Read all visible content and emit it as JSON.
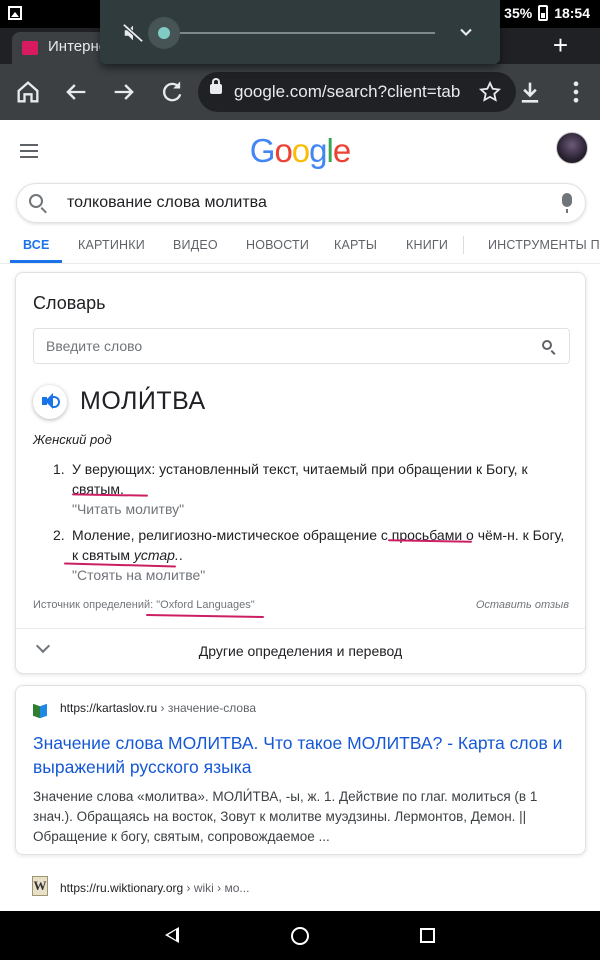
{
  "status_bar": {
    "battery": "35%",
    "time": "18:54"
  },
  "volume": {
    "level": 0.0,
    "mute_icon": "volume-off-icon"
  },
  "browser": {
    "tab_title": "Интерне",
    "url": "google.com/search?client=tab",
    "icons": [
      "home-icon",
      "back-arrow-icon",
      "forward-arrow-icon",
      "refresh-icon",
      "lock-icon",
      "star-icon",
      "download-icon",
      "more-vert-icon"
    ]
  },
  "google": {
    "logo_letters": [
      {
        "ch": "G",
        "color": "#4285F4"
      },
      {
        "ch": "o",
        "color": "#EA4335"
      },
      {
        "ch": "o",
        "color": "#FBBC05"
      },
      {
        "ch": "g",
        "color": "#4285F4"
      },
      {
        "ch": "l",
        "color": "#34A853"
      },
      {
        "ch": "e",
        "color": "#EA4335"
      }
    ]
  },
  "search": {
    "query": "толкование слова молитва"
  },
  "tabs": [
    {
      "label": "ВСЕ",
      "active": true
    },
    {
      "label": "КАРТИНКИ"
    },
    {
      "label": "ВИДЕО"
    },
    {
      "label": "НОВОСТИ"
    },
    {
      "label": "КАРТЫ"
    },
    {
      "label": "КНИГИ"
    },
    {
      "label": "ИНСТРУМЕНТЫ ПО"
    }
  ],
  "dictionary": {
    "title": "Словарь",
    "input_placeholder": "Введите слово",
    "word": "МОЛИ́ТВА",
    "gender": "Женский род",
    "definitions": [
      {
        "num": "1.",
        "line1": "У верующих: установленный текст, читаемый при обращении к Богу, к",
        "line2": "святым.",
        "example": "\"Читать молитву\""
      },
      {
        "num": "2.",
        "line1": "Моление, религиозно-мистическое обращение с просьбами о чём-н. к Богу,",
        "line2_a": "к святым ",
        "line2_b": "устар.",
        "line2_c": ".",
        "example": "\"Стоять на молитве\""
      }
    ],
    "source_label": "Источник определений: ",
    "source_name": "\"Oxford Languages\"",
    "feedback": "Оставить отзыв",
    "more": "Другие определения и перевод"
  },
  "accent_colors": {
    "link": "#1558d6",
    "tab_active": "#1a73e8",
    "annotation_ink": "#cc1f63"
  },
  "result1": {
    "site": "https://kartaslov.ru",
    "breadcrumb": " › значение-слова",
    "title": "Значение слова МОЛИТВА. Что такое МОЛИТВА? - Карта слов и выражений русского языка",
    "snippet": "Значение слова «молитва». МОЛИ́ТВА, -ы, ж. 1. Действие по глаг. молиться (в 1 знач.). Обращаясь на восток, Зовут к молитве муэдзины. Лермонтов, Демон. || Обращение к богу, святым, сопровождаемое ..."
  },
  "result2": {
    "favicon_letter": "W",
    "site": "https://ru.wiktionary.org",
    "breadcrumb": " › wiki › мо..."
  }
}
